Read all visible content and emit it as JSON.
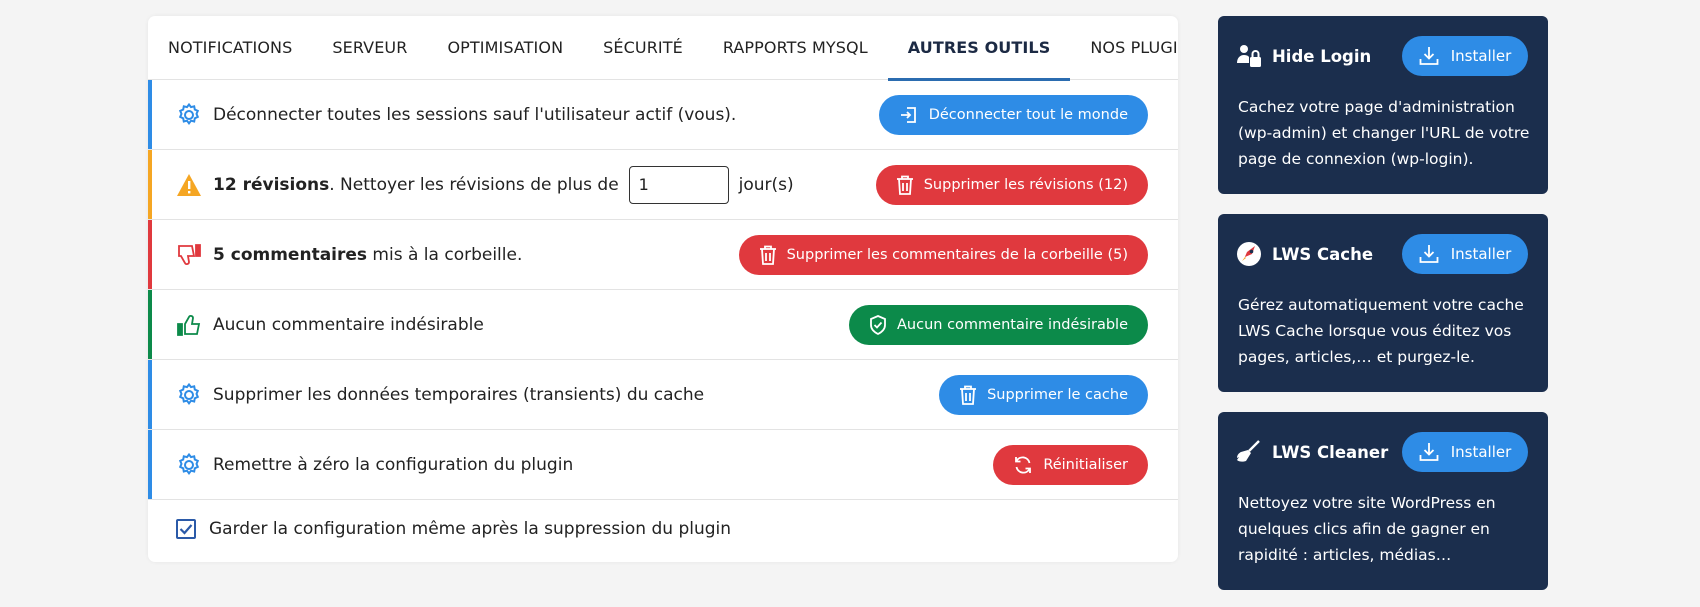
{
  "tabs": [
    {
      "label": "NOTIFICATIONS"
    },
    {
      "label": "SERVEUR"
    },
    {
      "label": "OPTIMISATION"
    },
    {
      "label": "SÉCURITÉ"
    },
    {
      "label": "RAPPORTS MYSQL"
    },
    {
      "label": "AUTRES OUTILS"
    },
    {
      "label": "NOS PLUGINS"
    }
  ],
  "active_tab": "AUTRES OUTILS",
  "rows": {
    "logout": {
      "text": "Déconnecter toutes les sessions sauf l'utilisateur actif (vous).",
      "button": "Déconnecter tout le monde"
    },
    "revisions": {
      "count": "12 révisions",
      "text": ". Nettoyer les révisions de plus de",
      "days_value": "1",
      "unit": "jour(s)",
      "button": "Supprimer les révisions (12)"
    },
    "trash": {
      "count": "5 commentaires",
      "text": " mis à la corbeille.",
      "button": "Supprimer les commentaires de la corbeille (5)"
    },
    "spam": {
      "text": "Aucun commentaire indésirable",
      "button": "Aucun commentaire indésirable"
    },
    "cache": {
      "text": "Supprimer les données temporaires (transients) du cache",
      "button": "Supprimer le cache"
    },
    "reset": {
      "text": "Remettre à zéro la configuration du plugin",
      "button": "Réinitialiser"
    }
  },
  "keep_config": {
    "label": "Garder la configuration même après la suppression du plugin",
    "checked": true
  },
  "plugins": [
    {
      "name": "Hide Login",
      "install": "Installer",
      "desc": "Cachez votre page d'administration (wp-admin) et changer l'URL de votre page de connexion (wp-login)."
    },
    {
      "name": "LWS Cache",
      "install": "Installer",
      "desc": "Gérez automatiquement votre cache LWS Cache lorsque vous éditez vos pages, articles,… et purgez-le."
    },
    {
      "name": "LWS Cleaner",
      "install": "Installer",
      "desc": "Nettoyez votre site WordPress en quelques clics afin de gagner en rapidité : articles, médias…"
    }
  ],
  "colors": {
    "accent_blue": "#2e8ce6",
    "danger_red": "#e0393e",
    "success_green": "#0c8a4a",
    "warning_orange": "#f5a623",
    "sidebar_navy": "#1b2e4d"
  },
  "icons": {
    "logout": "gear-icon",
    "revisions": "warning-icon",
    "trash": "thumbs-down-icon",
    "spam": "thumbs-up-icon",
    "cache": "gear-icon",
    "reset": "gear-icon",
    "hide_login": "user-lock-icon",
    "lws_cache": "rocket-icon",
    "lws_cleaner": "broom-icon"
  }
}
